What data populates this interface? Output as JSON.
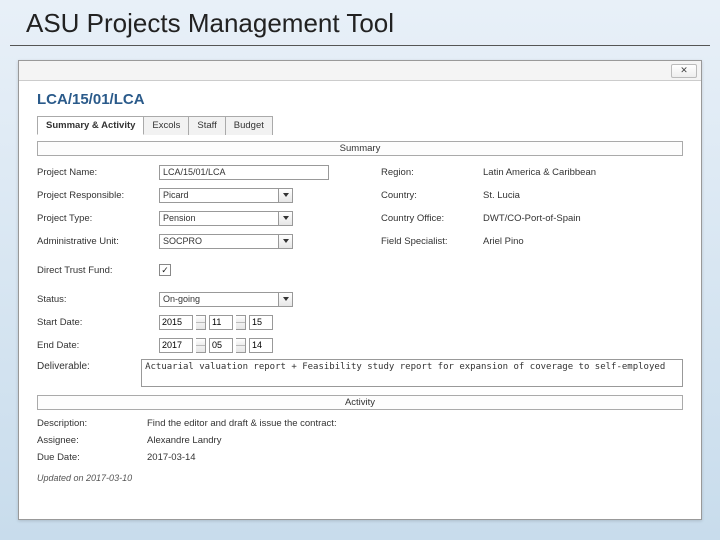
{
  "slide": {
    "title": "ASU Projects Management Tool"
  },
  "window": {
    "close_label": "✕"
  },
  "record": {
    "title": "LCA/15/01/LCA"
  },
  "tabs": {
    "summary": "Summary & Activity",
    "excols": "Excols",
    "staff": "Staff",
    "budget": "Budget"
  },
  "sections": {
    "summary": "Summary",
    "activity": "Activity"
  },
  "labels": {
    "project_name": "Project Name:",
    "project_responsible": "Project Responsible:",
    "project_type": "Project Type:",
    "admin_unit": "Administrative Unit:",
    "direct_trust_fund": "Direct Trust Fund:",
    "status": "Status:",
    "start_date": "Start Date:",
    "end_date": "End Date:",
    "deliverable": "Deliverable:",
    "description": "Description:",
    "assignee": "Assignee:",
    "due_date": "Due Date:",
    "region": "Region:",
    "country": "Country:",
    "country_office": "Country Office:",
    "field_specialist": "Field Specialist:"
  },
  "values": {
    "project_name": "LCA/15/01/LCA",
    "project_responsible": "Picard",
    "project_type": "Pension",
    "admin_unit": "SOCPRO",
    "direct_trust_fund_checked": true,
    "status": "On-going",
    "start_date": {
      "y": "2015",
      "m": "11",
      "d": "15"
    },
    "end_date": {
      "y": "2017",
      "m": "05",
      "d": "14"
    },
    "deliverable": "Actuarial valuation report + Feasibility study report for expansion of coverage to self-employed",
    "region": "Latin America & Caribbean",
    "country": "St. Lucia",
    "country_office": "DWT/CO-Port-of-Spain",
    "field_specialist": "Ariel Pino"
  },
  "activity": {
    "description": "Find the editor and draft & issue the contract:",
    "assignee": "Alexandre Landry",
    "due_date": "2017-03-14"
  },
  "footer": {
    "updated": "Updated on 2017-03-10"
  }
}
